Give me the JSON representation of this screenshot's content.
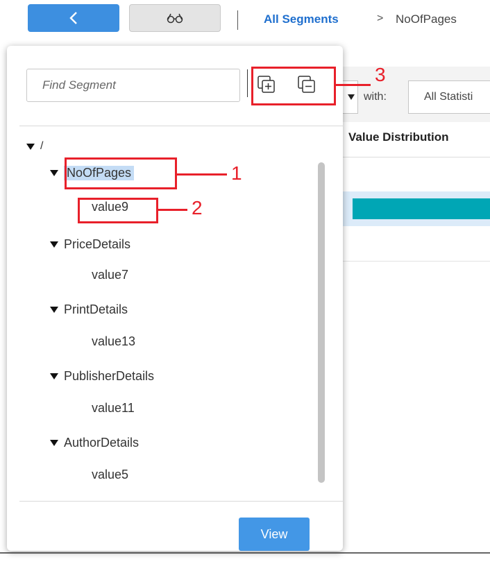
{
  "toolbar": {
    "back_icon": "chevron-left-icon",
    "glasses_icon": "glasses-icon"
  },
  "breadcrumb": {
    "root": "All Segments",
    "separator": ">",
    "current": "NoOfPages"
  },
  "background": {
    "with_label": "with:",
    "statistics_select": "All Statisti",
    "column_header": "Value Distribution",
    "bar_color": "#00a6b5"
  },
  "panel": {
    "search_placeholder": "Find Segment",
    "expand_all_icon": "expand-all-icon",
    "collapse_all_icon": "collapse-all-icon",
    "tree": {
      "root": "/",
      "items": [
        {
          "label": "NoOfPages",
          "child": "value9",
          "selected": true
        },
        {
          "label": "PriceDetails",
          "child": "value7"
        },
        {
          "label": "PrintDetails",
          "child": "value13"
        },
        {
          "label": "PublisherDetails",
          "child": "value11"
        },
        {
          "label": "AuthorDetails",
          "child": "value5"
        }
      ]
    },
    "view_button": "View"
  },
  "annotations": [
    "1",
    "2",
    "3"
  ],
  "colors": {
    "accent": "#3d8fe0",
    "link": "#1f6fce",
    "annotation": "#e8202a",
    "selection": "#c4dcf5"
  }
}
